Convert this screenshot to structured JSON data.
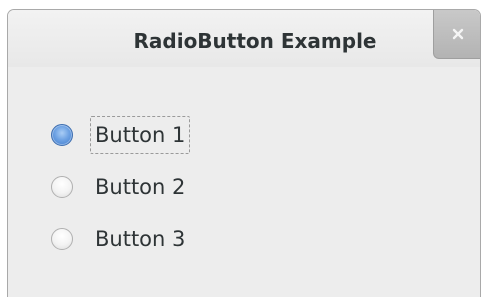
{
  "window": {
    "title": "RadioButton Example",
    "close_icon": "close-x-icon"
  },
  "radio_group": {
    "selected_index": 0,
    "focused_index": 0,
    "options": [
      {
        "label": "Button 1",
        "checked": true
      },
      {
        "label": "Button 2",
        "checked": false
      },
      {
        "label": "Button 3",
        "checked": false
      }
    ]
  },
  "colors": {
    "accent": "#4a86d8",
    "window_bg": "#ededed",
    "text": "#2e3436"
  }
}
